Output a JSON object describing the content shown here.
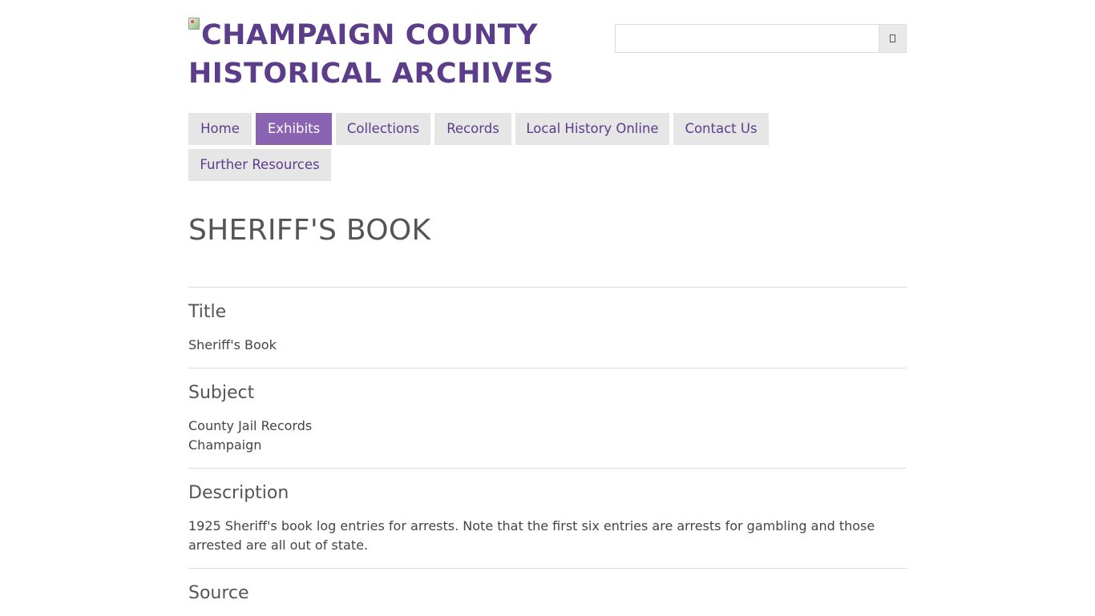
{
  "header": {
    "logo_text": "CHAMPAIGN COUNTY HISTORICAL ARCHIVES",
    "search": {
      "value": "",
      "placeholder": "",
      "button_icon": "search-icon"
    }
  },
  "nav": {
    "items": [
      {
        "label": "Home",
        "active": false
      },
      {
        "label": "Exhibits",
        "active": true
      },
      {
        "label": "Collections",
        "active": false
      },
      {
        "label": "Records",
        "active": false
      },
      {
        "label": "Local History Online",
        "active": false
      },
      {
        "label": "Contact Us",
        "active": false
      },
      {
        "label": "Further Resources",
        "active": false
      }
    ]
  },
  "page": {
    "title": "SHERIFF'S BOOK"
  },
  "fields": [
    {
      "label": "Title",
      "values": [
        "Sheriff's Book"
      ]
    },
    {
      "label": "Subject",
      "values": [
        "County Jail Records",
        "Champaign"
      ]
    },
    {
      "label": "Description",
      "values": [
        "1925 Sheriff's book log entries for arrests. Note that the first six entries are arrests for gambling and those arrested are all out of state."
      ]
    },
    {
      "label": "Source",
      "values": []
    }
  ],
  "colors": {
    "brand_purple": "#5b3d8a",
    "active_tab": "#8a64b2",
    "tab_background": "#e6e6e6",
    "divider": "#dddddd"
  }
}
